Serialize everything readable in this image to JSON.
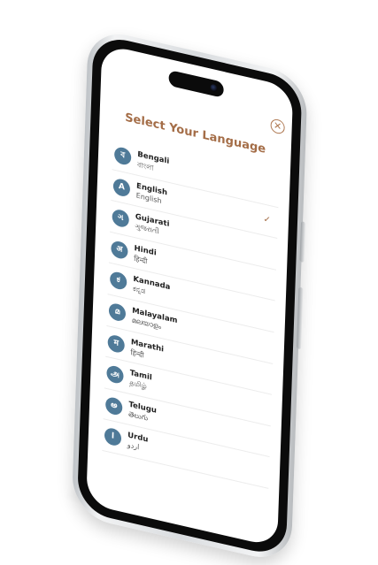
{
  "header": {
    "title": "Select Your Language",
    "close_icon": "close-circle-icon"
  },
  "accent_color": "#a46d47",
  "badge_color": "#4f7a98",
  "languages": [
    {
      "name": "Bengali",
      "native": "বাংলা",
      "glyph": "ব",
      "selected": false
    },
    {
      "name": "English",
      "native": "English",
      "glyph": "A",
      "selected": true
    },
    {
      "name": "Gujarati",
      "native": "ગુજરાતી",
      "glyph": "ગ",
      "selected": false
    },
    {
      "name": "Hindi",
      "native": "हिन्दी",
      "glyph": "अ",
      "selected": false
    },
    {
      "name": "Kannada",
      "native": "ಕನ್ನಡ",
      "glyph": "ಕ",
      "selected": false
    },
    {
      "name": "Malayalam",
      "native": "മലയാളം",
      "glyph": "മ",
      "selected": false
    },
    {
      "name": "Marathi",
      "native": "हिन्दी",
      "glyph": "म",
      "selected": false
    },
    {
      "name": "Tamil",
      "native": "தமிழ்",
      "glyph": "அ",
      "selected": false
    },
    {
      "name": "Telugu",
      "native": "తెలుగు",
      "glyph": "అ",
      "selected": false
    },
    {
      "name": "Urdu",
      "native": "اردو",
      "glyph": "ا",
      "selected": false
    }
  ],
  "check_icon": "checkmark-icon"
}
